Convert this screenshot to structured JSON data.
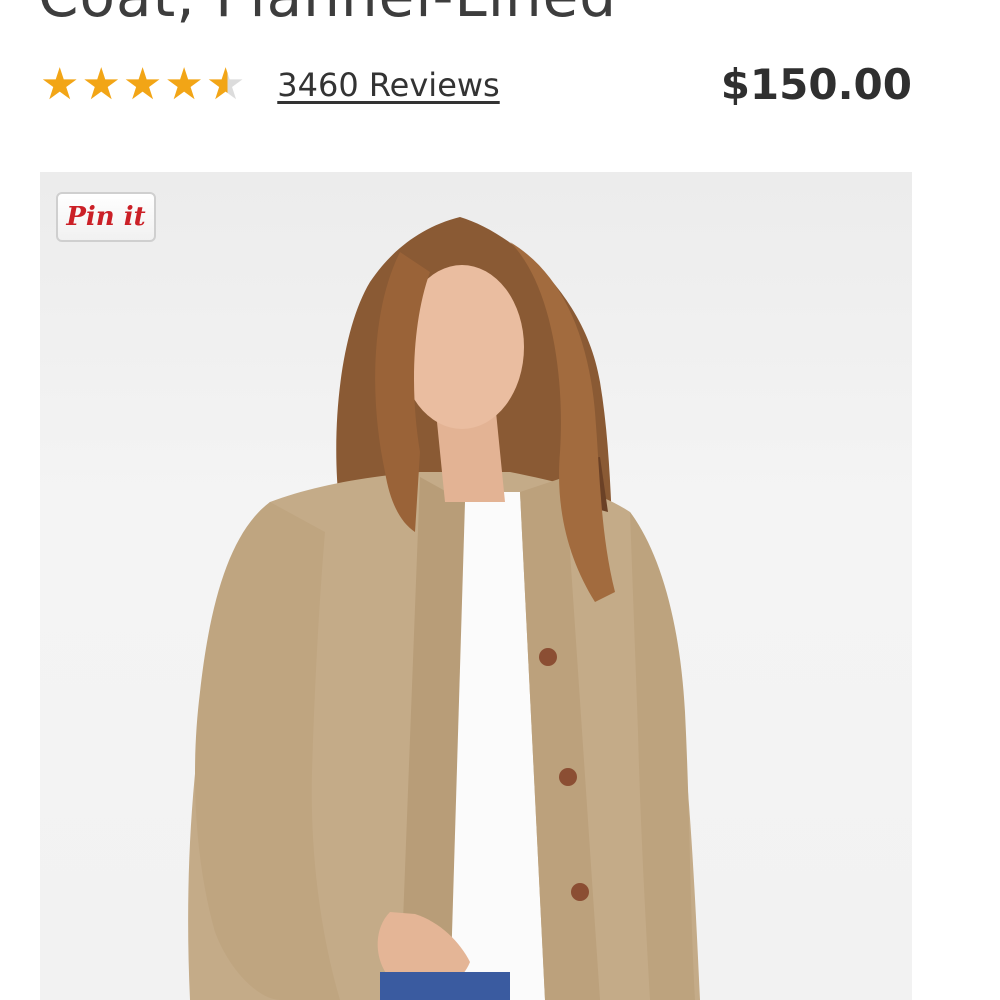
{
  "product": {
    "title": "Coat, Flannel-Lined",
    "rating_value": 4.5,
    "rating_max": 5,
    "reviews_label": "3460 Reviews",
    "price": "$150.00"
  },
  "image": {
    "pin_label": "Pin it",
    "alt": "Model wearing khaki field coat"
  },
  "colors": {
    "star": "#f2a516",
    "pin": "#cb2027",
    "coat": "#c4ab88"
  },
  "icons": {
    "star": "star-icon",
    "pin": "pinterest-pin-icon"
  }
}
